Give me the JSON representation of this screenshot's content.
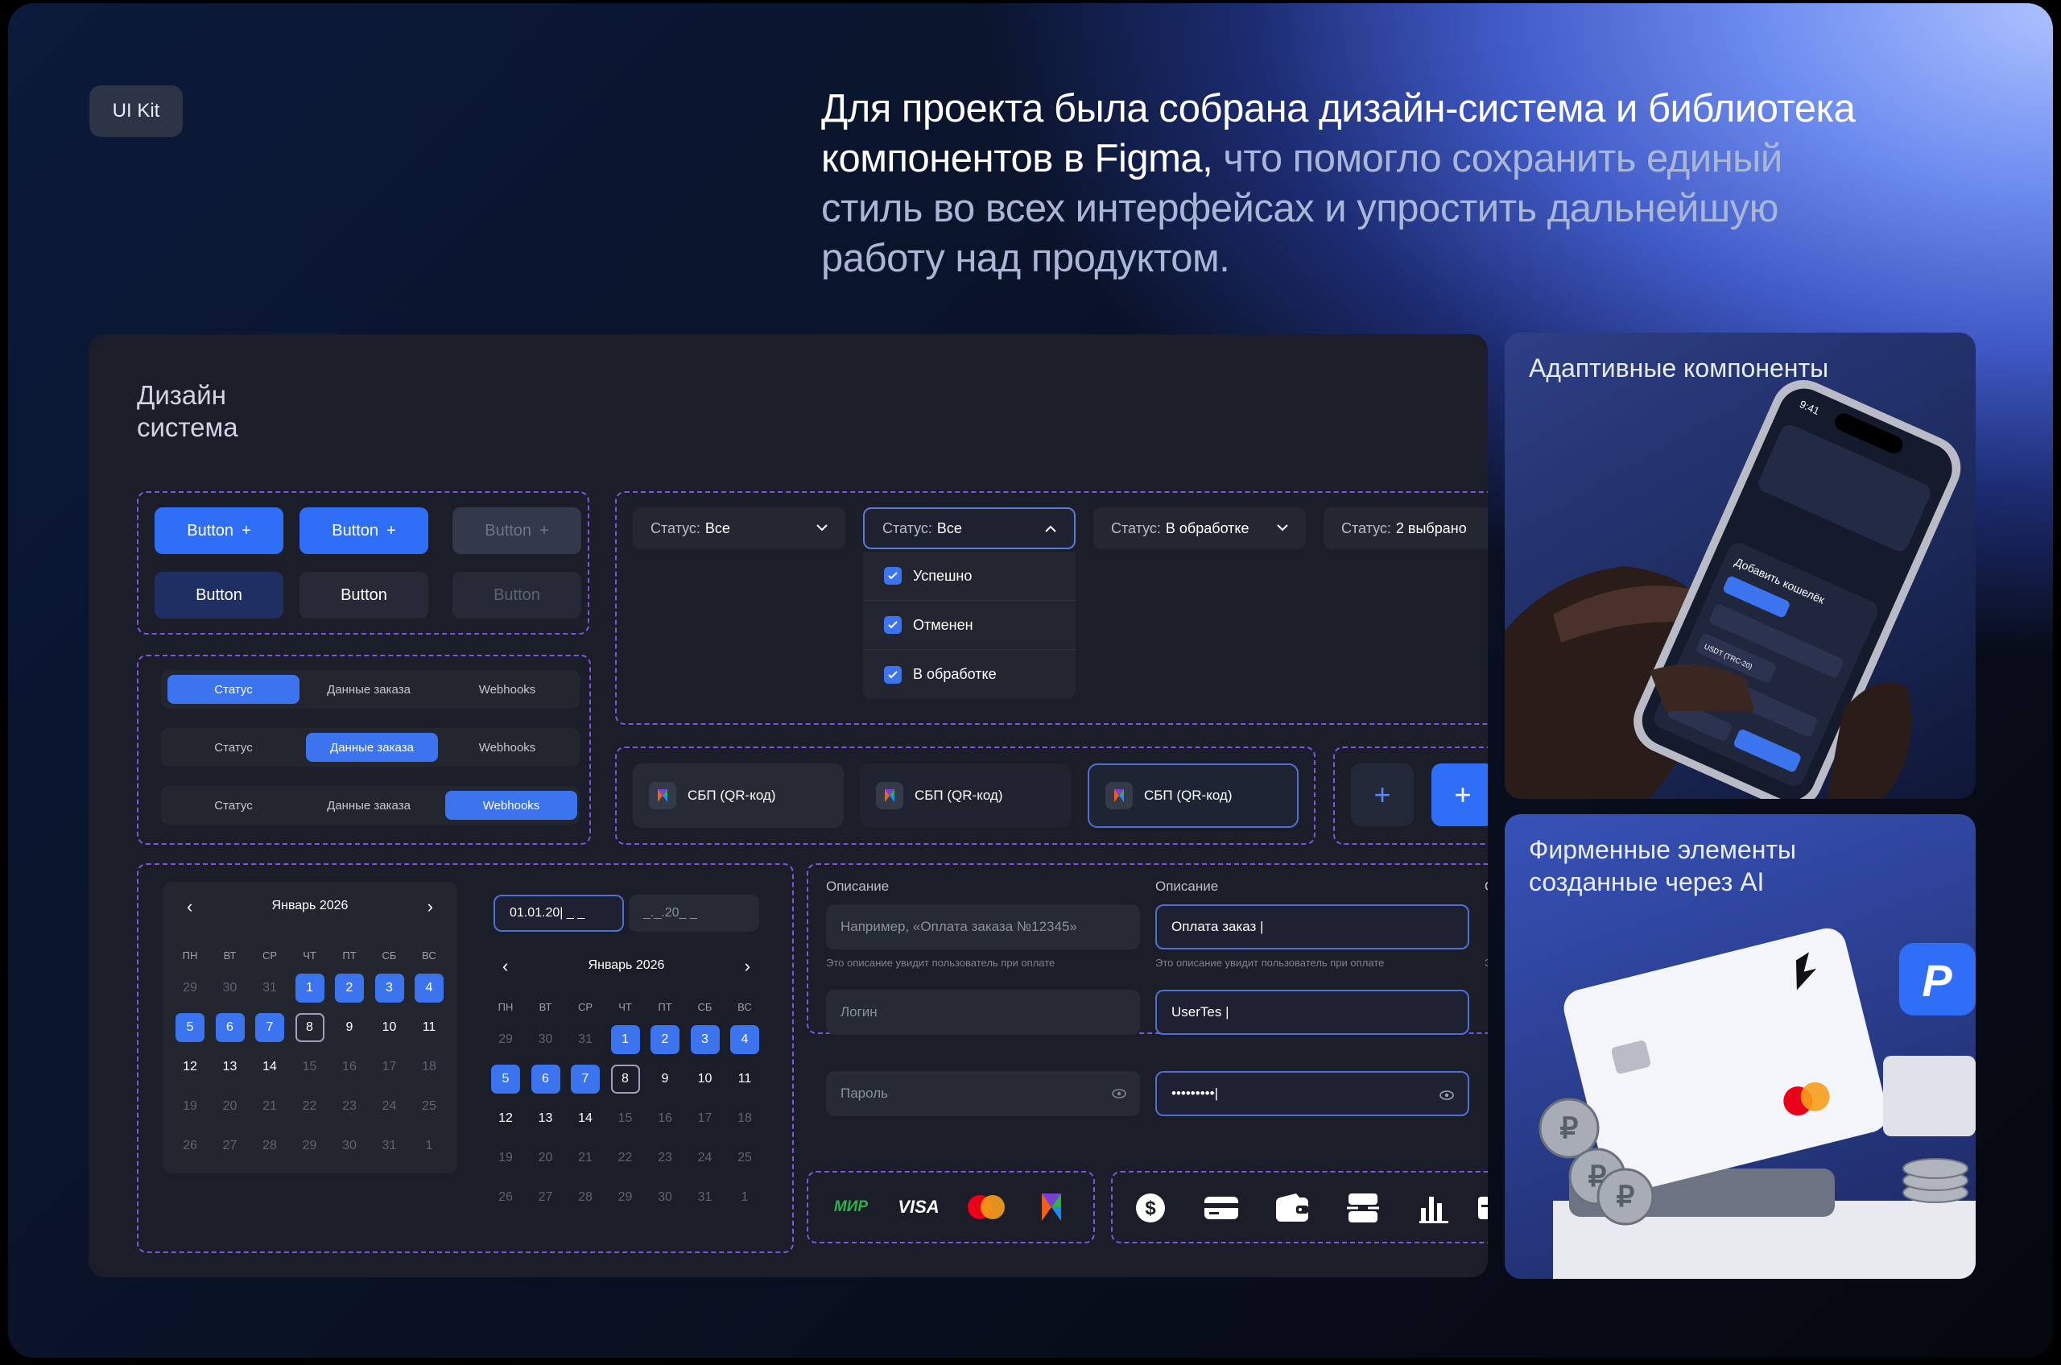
{
  "badge": "UI Kit",
  "headline": {
    "white": "Для проекта была собрана дизайн-система и библиотека компонентов в Figma,",
    "dim": " что помогло сохранить единый стиль во всех интерфейсах и упростить дальнейшую работу над продуктом."
  },
  "panel": {
    "title": "Дизайн система"
  },
  "buttons": {
    "label": "Button"
  },
  "tabs": [
    "Статус",
    "Данные заказа",
    "Webhooks"
  ],
  "dropdowns": [
    {
      "label": "Статус:",
      "value": "Все"
    },
    {
      "label": "Статус:",
      "value": "Все"
    },
    {
      "label": "Статус:",
      "value": "В обработке"
    },
    {
      "label": "Статус:",
      "value": "2 выбрано"
    }
  ],
  "menu": [
    "Успешно",
    "Отменен",
    "В обработке"
  ],
  "payment": {
    "label": "СБП (QR-код)"
  },
  "calendar": {
    "month": "Январь 2026",
    "dow": [
      "ПН",
      "ВТ",
      "СР",
      "ЧТ",
      "ПТ",
      "СБ",
      "ВС"
    ],
    "days": [
      "29",
      "30",
      "31",
      "1",
      "2",
      "3",
      "4",
      "5",
      "6",
      "7",
      "8",
      "9",
      "10",
      "11",
      "12",
      "13",
      "14",
      "15",
      "16",
      "17",
      "18",
      "19",
      "20",
      "21",
      "22",
      "23",
      "24",
      "25",
      "26",
      "27",
      "28",
      "29",
      "30",
      "31",
      "1"
    ]
  },
  "date_inputs": {
    "from": "01.01.20| _ _",
    "to": "_._.20_ _"
  },
  "form": {
    "desc_label": "Описание",
    "desc_placeholder": "Например, «Оплата заказа №12345»",
    "desc_value": "Оплата заказ |",
    "desc_hint": "Это описание увидит пользователь при оплате",
    "login_placeholder": "Логин",
    "login_value": "UserTes |",
    "pass_placeholder": "Пароль",
    "pass_value": "•••••••••|",
    "cut_label": "Ог",
    "cut_hint": "Эт"
  },
  "logos": {
    "mir": "МИР",
    "visa": "VISA"
  },
  "cards": {
    "adaptive": "Адаптивные компоненты",
    "ai": "Фирменные элементы созданные через AI"
  },
  "phone": {
    "time": "9:41",
    "dialog": "Добавить кошелёк",
    "currency": "USDT (TRC-20)"
  },
  "colors": {
    "accent": "#3b74ee",
    "dashed": "#7b56e0",
    "panel": "#1b1e29"
  }
}
